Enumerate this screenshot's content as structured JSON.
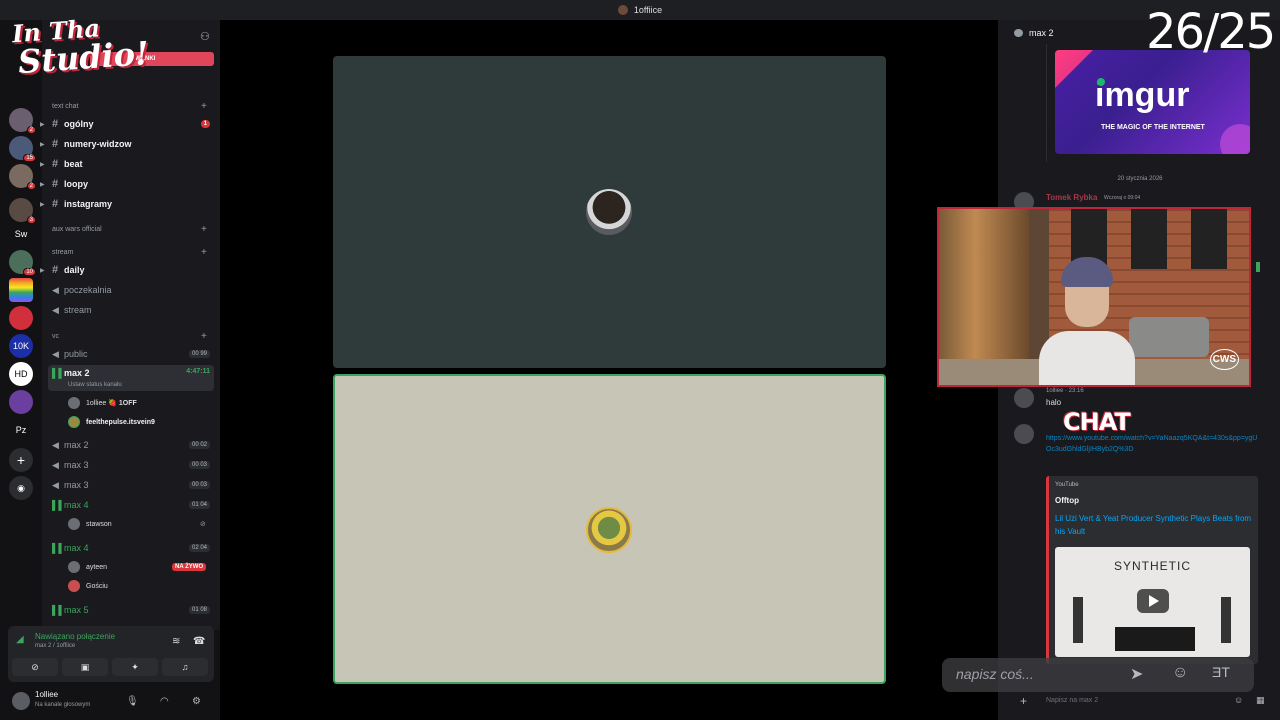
{
  "window": {
    "title": "1offiice"
  },
  "overlay": {
    "counter": "26/25",
    "chat_label": "CHAT",
    "input_placeholder": "napisz coś..."
  },
  "server": {
    "logo_line1": "In Tha",
    "logo_line2": "Studio!",
    "ribbon": "MIANKI"
  },
  "rail": [
    {
      "label": "",
      "badge": "2"
    },
    {
      "label": "",
      "badge": "15"
    },
    {
      "label": "",
      "badge": "2"
    },
    {
      "label": "",
      "badge": "3"
    },
    {
      "label": "Sw",
      "badge": ""
    },
    {
      "label": "",
      "badge": "10"
    },
    {
      "label": "",
      "badge": ""
    },
    {
      "label": "",
      "badge": ""
    },
    {
      "label": "10K",
      "badge": ""
    },
    {
      "label": "HD",
      "badge": ""
    },
    {
      "label": "",
      "badge": ""
    },
    {
      "label": "Pz",
      "badge": ""
    }
  ],
  "categories": {
    "text_chat": "text chat",
    "aux_wars": "aux wars official",
    "stream": "stream",
    "vc": "vc"
  },
  "channels": {
    "ogolny": {
      "label": "ogólny",
      "badge": "1"
    },
    "numery": {
      "label": "numery-widzow"
    },
    "beat": {
      "label": "beat"
    },
    "loopy": {
      "label": "loopy"
    },
    "instagramy": {
      "label": "instagramy"
    },
    "daily": {
      "label": "daily"
    },
    "poczekalnia": {
      "label": "poczekalnia"
    },
    "stream": {
      "label": "stream"
    },
    "public": {
      "label": "public",
      "count": "00 99"
    },
    "max2_active": {
      "label": "max 2",
      "timer": "4:47:11",
      "status": "Ustaw status kanału"
    },
    "max2b": {
      "label": "max 2",
      "count": "00 02"
    },
    "max3a": {
      "label": "max 3",
      "count": "00 03"
    },
    "max3b": {
      "label": "max 3",
      "count": "00 03"
    },
    "max4a": {
      "label": "max 4",
      "count": "01 04"
    },
    "max4b": {
      "label": "max 4",
      "count": "02 04"
    },
    "max5": {
      "label": "max 5",
      "count": "01 08"
    }
  },
  "members": {
    "m1": "1olliee",
    "m1_tag": "🍓 1OFF",
    "m2": "feelthepulse.itsvein9",
    "m3": "stawson",
    "m4": "ayteen",
    "m4_live": "NA ŻYWO",
    "m5": "Gościu"
  },
  "voice": {
    "status": "Nawiązano połączenie",
    "sub": "max 2 / 1offiice"
  },
  "user": {
    "name": "1olliee",
    "status": "Na kanale głosowym"
  },
  "chat": {
    "title": "max 2",
    "imgur_word": "imgur",
    "imgur_tagline": "THE MAGIC OF THE INTERNET",
    "date": "20 stycznia 2026",
    "author1": "Tomek Rybka",
    "time1": "Wczoraj o 09:04",
    "author2": "1olliee · 23:16",
    "msg2": "halo",
    "link": "https://www.youtube.com/watch?v=YaNaazq5KQA&t=430s&pp=ygUOc3udGhldGljIHByb2Q%3D",
    "embed_provider": "YouTube",
    "embed_author": "Offtop",
    "embed_title": "Lil Uzi Vert & Yeat Producer Synthetic Plays Beats from his Vault",
    "thumb_text": "SYNTHETIC",
    "input_placeholder": "Napisz na max 2"
  }
}
